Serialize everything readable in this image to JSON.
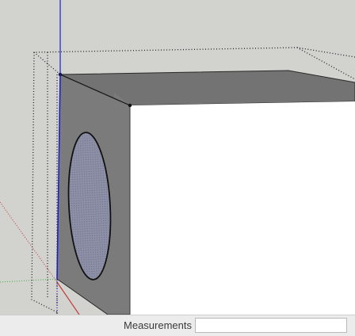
{
  "status_bar": {
    "measurements_label": "Measurements",
    "measurements_value": ""
  },
  "colors": {
    "viewport_background": "#d2d2cf",
    "face_gray": "#7b7b7b",
    "top_face_gray": "#6f6f6f",
    "inner_face": "#ffffff",
    "circle_fill": "#8c8fa6",
    "blue_axis": "#1b1bd1",
    "green_axis": "#3fae3f",
    "red_axis": "#c43a3a"
  },
  "icons": {
    "model": "3d-box-model-icon"
  }
}
